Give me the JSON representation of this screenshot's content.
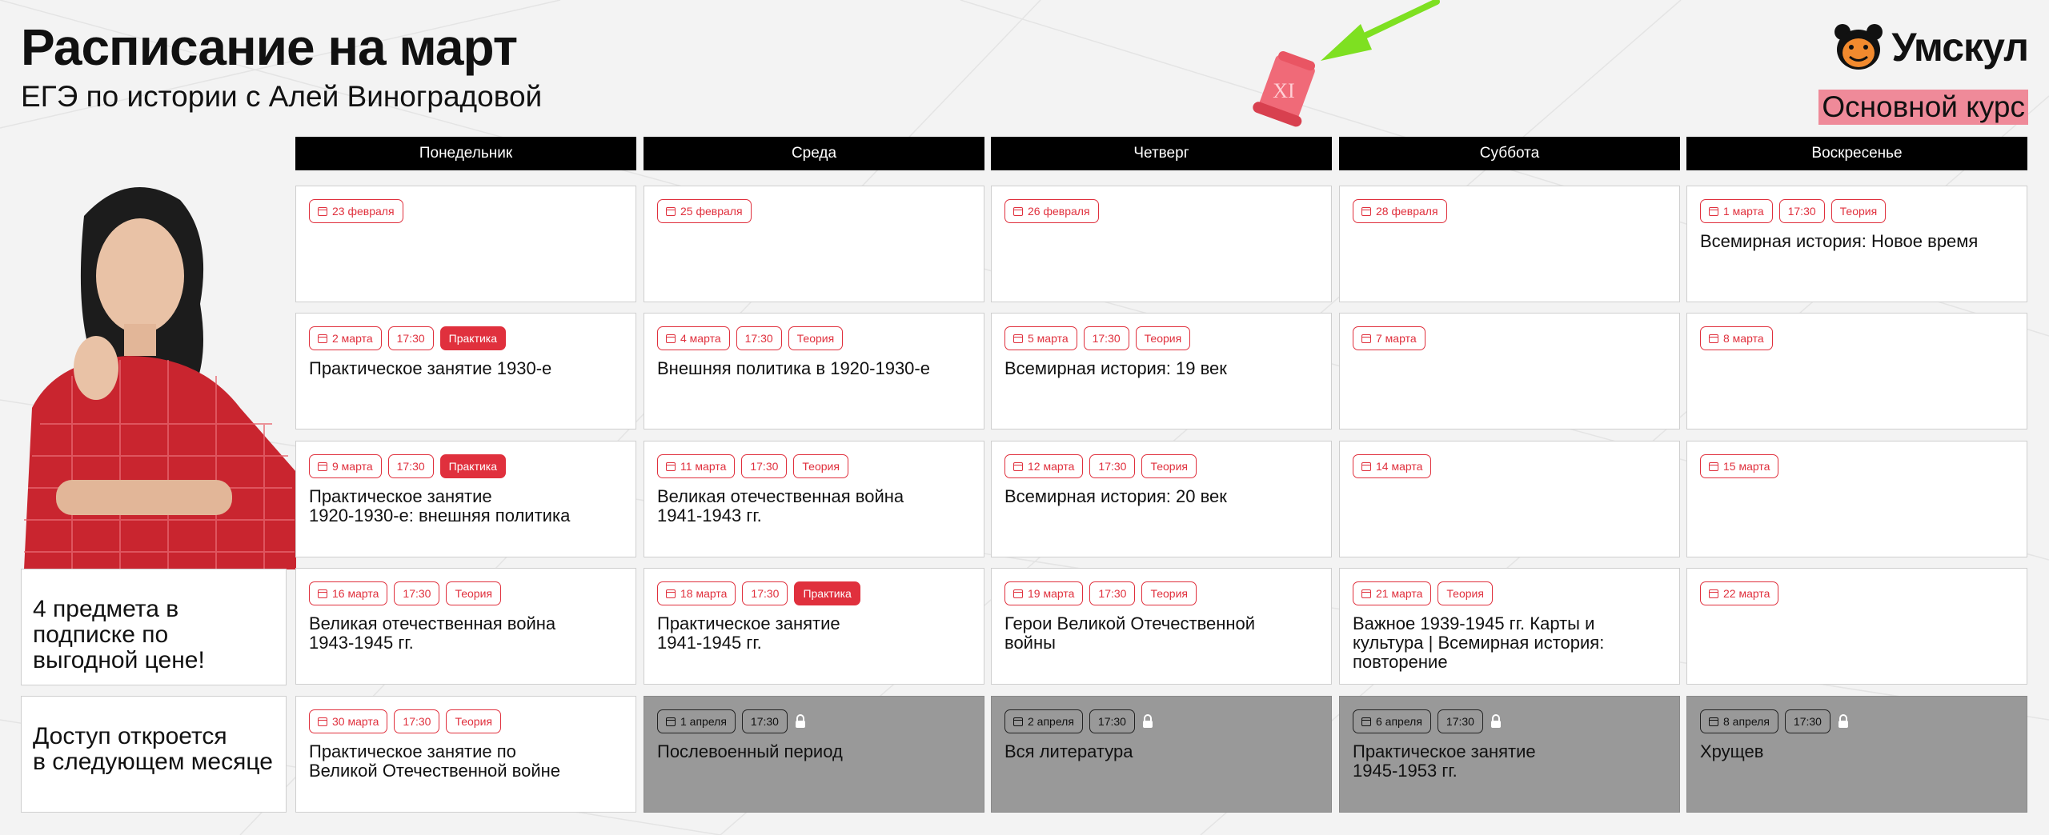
{
  "header": {
    "title": "Расписание на март",
    "subtitle": "ЕГЭ по истории с Алей Виноградовой",
    "brand": "Умскул",
    "course_badge": "Основной курс",
    "scroll_text": "XI"
  },
  "colors": {
    "accent": "#e0303d",
    "badge_bg": "#ef8a99",
    "arrow": "#7ee021",
    "locked": "#999999"
  },
  "days": [
    "Понедельник",
    "Среда",
    "Четверг",
    "Суббота",
    "Воскресенье"
  ],
  "side": {
    "promo": [
      "4 предмета в",
      "подписке по",
      "выгодной цене!"
    ],
    "access": [
      "Доступ откроется",
      "в следующем месяце"
    ]
  },
  "icons": {
    "calendar": "calendar-icon",
    "lock": "lock-icon",
    "arrow": "arrow-icon",
    "scroll": "scroll-icon",
    "logo": "bear-logo-icon"
  },
  "weeks": [
    [
      {
        "date": "23 февраля"
      },
      {
        "date": "25 февраля"
      },
      {
        "date": "26 февраля"
      },
      {
        "date": "28 февраля"
      },
      {
        "date": "1 марта",
        "time": "17:30",
        "tag": "Теория",
        "lesson": [
          "Всемирная история: Новое время"
        ]
      }
    ],
    [
      {
        "date": "2 марта",
        "time": "17:30",
        "tag": "Практика",
        "tag_fill": true,
        "lesson": [
          "Практическое занятие 1930-е"
        ]
      },
      {
        "date": "4 марта",
        "time": "17:30",
        "tag": "Теория",
        "lesson": [
          "Внешняя политика в 1920-1930-е"
        ]
      },
      {
        "date": "5 марта",
        "time": "17:30",
        "tag": "Теория",
        "lesson": [
          "Всемирная история: 19 век"
        ]
      },
      {
        "date": "7 марта"
      },
      {
        "date": "8 марта"
      }
    ],
    [
      {
        "date": "9 марта",
        "time": "17:30",
        "tag": "Практика",
        "tag_fill": true,
        "lesson": [
          "Практическое занятие",
          "1920-1930-е: внешняя политика"
        ]
      },
      {
        "date": "11 марта",
        "time": "17:30",
        "tag": "Теория",
        "lesson": [
          "Великая отечественная война",
          "1941-1943 гг."
        ]
      },
      {
        "date": "12 марта",
        "time": "17:30",
        "tag": "Теория",
        "lesson": [
          "Всемирная история: 20 век"
        ]
      },
      {
        "date": "14 марта"
      },
      {
        "date": "15 марта"
      }
    ],
    [
      {
        "date": "16 марта",
        "time": "17:30",
        "tag": "Теория",
        "lesson": [
          "Великая отечественная война",
          "1943-1945 гг."
        ]
      },
      {
        "date": "18 марта",
        "time": "17:30",
        "tag": "Практика",
        "tag_fill": true,
        "lesson": [
          "Практическое занятие",
          "1941-1945 гг."
        ]
      },
      {
        "date": "19 марта",
        "time": "17:30",
        "tag": "Теория",
        "lesson": [
          "Герои Великой Отечественной",
          "войны"
        ]
      },
      {
        "date": "21 марта",
        "tag": "Теория",
        "lesson": [
          "Важное 1939-1945 гг. Карты и",
          "культура | Всемирная история:",
          "повторение"
        ]
      },
      {
        "date": "22 марта"
      }
    ],
    [
      {
        "date": "30 марта",
        "time": "17:30",
        "tag": "Теория",
        "lesson": [
          "Практическое занятие по",
          "Великой Отечественной войне"
        ]
      },
      {
        "date": "1 апреля",
        "time": "17:30",
        "locked": true,
        "lesson": [
          "Послевоенный период"
        ]
      },
      {
        "date": "2 апреля",
        "time": "17:30",
        "locked": true,
        "lesson": [
          "Вся литература"
        ]
      },
      {
        "date": "6 апреля",
        "time": "17:30",
        "locked": true,
        "lesson": [
          "Практическое занятие",
          "1945-1953 гг."
        ]
      },
      {
        "date": "8 апреля",
        "time": "17:30",
        "locked": true,
        "lesson": [
          "Хрущев"
        ]
      }
    ]
  ]
}
